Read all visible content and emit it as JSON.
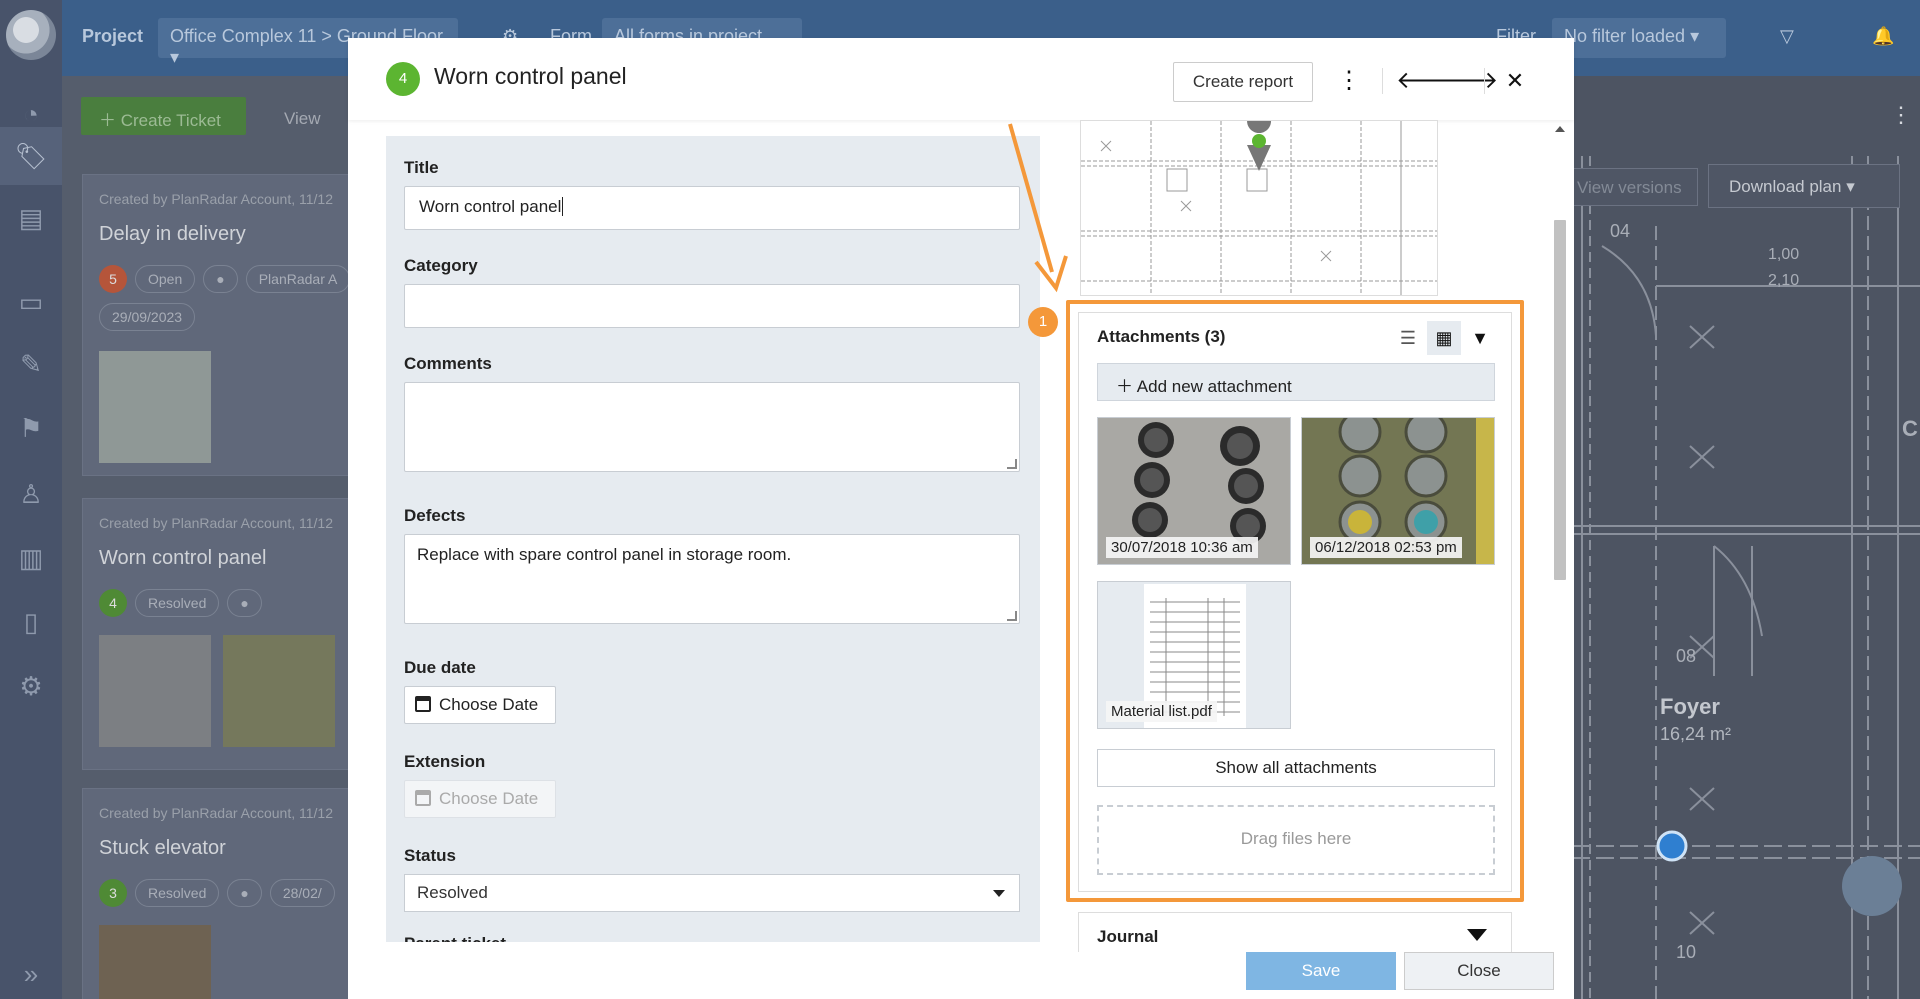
{
  "topbar": {
    "project_label": "Project",
    "project_value": "Office Complex 11 > Ground Floor",
    "form_label": "Form",
    "form_value": "All forms in project",
    "filter_label": "Filter",
    "filter_value": "No filter loaded"
  },
  "list": {
    "create_ticket": "Create Ticket",
    "view_label": "View",
    "cards": [
      {
        "meta": "Created by PlanRadar Account, 11/12",
        "title": "Delay in delivery",
        "number": "5",
        "status": "Open",
        "assignee": "PlanRadar A",
        "date": "29/09/2023",
        "color": "#b5553a"
      },
      {
        "meta": "Created by PlanRadar Account, 11/12",
        "title": "Worn control panel",
        "number": "4",
        "status": "Resolved",
        "color": "#4f8a35"
      },
      {
        "meta": "Created by PlanRadar Account, 11/12",
        "title": "Stuck elevator",
        "number": "3",
        "status": "Resolved",
        "date": "28/02/",
        "color": "#4f8a35"
      }
    ]
  },
  "plan_bg": {
    "view_versions": "View versions",
    "download_plan": "Download plan",
    "room_name": "Foyer",
    "room_area": "16,24 m²",
    "dims": [
      "1,00",
      "2,10",
      "04",
      "08",
      "10"
    ]
  },
  "modal": {
    "badge": "4",
    "title": "Worn control panel",
    "create_report": "Create report",
    "form": {
      "title_label": "Title",
      "title_value": "Worn control panel",
      "category_label": "Category",
      "category_value": "",
      "comments_label": "Comments",
      "comments_value": "",
      "defects_label": "Defects",
      "defects_value": "Replace with spare control panel in storage room.",
      "due_label": "Due date",
      "due_value": "Choose Date",
      "extension_label": "Extension",
      "extension_value": "Choose Date",
      "status_label": "Status",
      "status_value": "Resolved",
      "parent_label": "Parent ticket"
    },
    "attachments": {
      "title": "Attachments (3)",
      "add": "Add new attachment",
      "items": [
        {
          "label": "30/07/2018 10:36 am"
        },
        {
          "label": "06/12/2018 02:53 pm"
        },
        {
          "label": "Material list.pdf"
        }
      ],
      "show_all": "Show all attachments",
      "drop": "Drag files here"
    },
    "highlight_number": "1",
    "journal": "Journal",
    "save": "Save",
    "close": "Close"
  },
  "colors": {
    "accent_orange": "#f4983a",
    "badge_green": "#5cb531",
    "save_blue": "#7fb6e3"
  }
}
